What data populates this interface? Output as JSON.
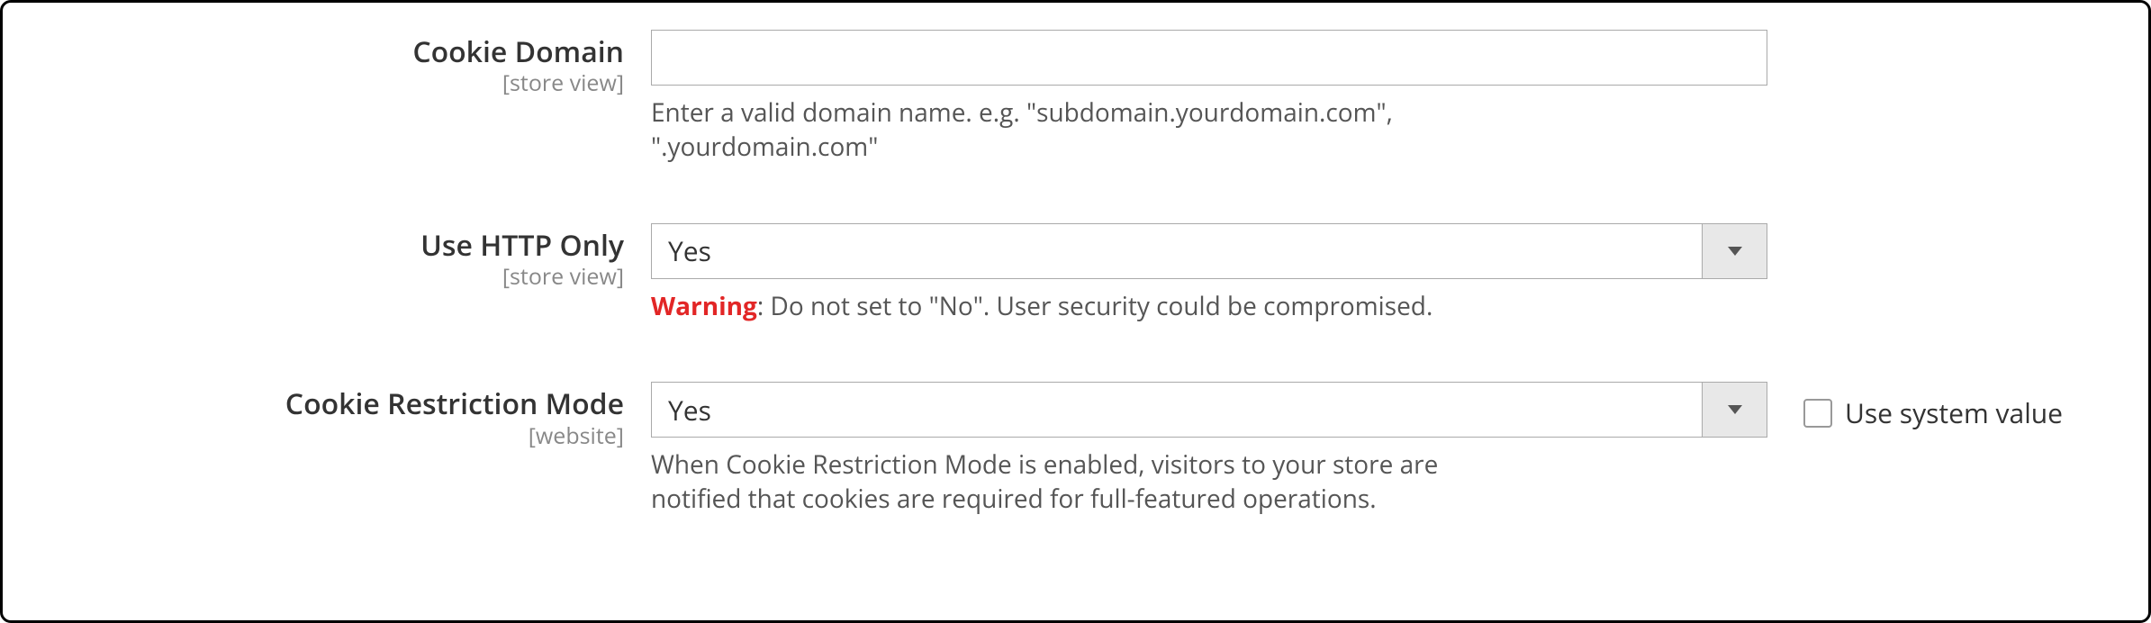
{
  "fields": {
    "cookie_domain": {
      "label": "Cookie Domain",
      "scope": "[store view]",
      "value": "",
      "help": "Enter a valid domain name. e.g. \"subdomain.yourdomain.com\", \".yourdomain.com\""
    },
    "use_http_only": {
      "label": "Use HTTP Only",
      "scope": "[store view]",
      "value": "Yes",
      "warning_label": "Warning",
      "warning_text": ": Do not set to \"No\". User security could be compromised."
    },
    "cookie_restriction_mode": {
      "label": "Cookie Restriction Mode",
      "scope": "[website]",
      "value": "Yes",
      "help": "When Cookie Restriction Mode is enabled, visitors to your store are notified that cookies are required for full-featured operations.",
      "use_system_label": "Use system value"
    }
  }
}
